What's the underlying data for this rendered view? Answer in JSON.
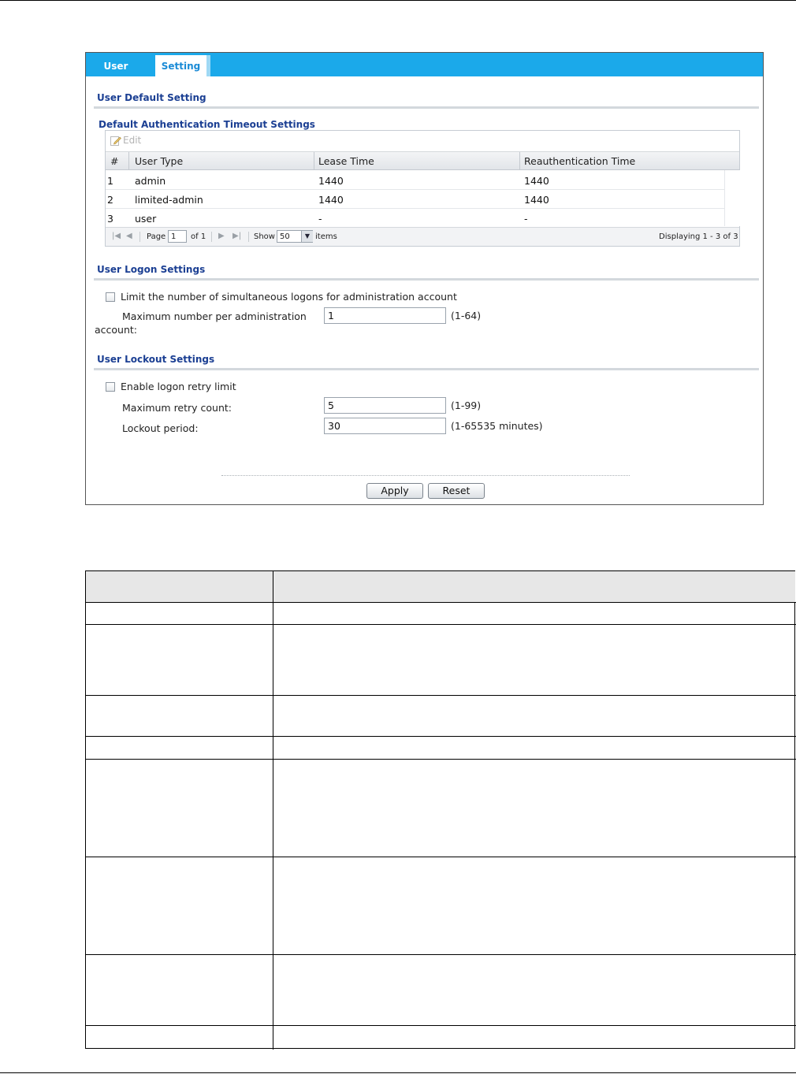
{
  "tabs": [
    {
      "label": "User",
      "active": false
    },
    {
      "label": "Setting",
      "active": true
    }
  ],
  "user_default": {
    "title": "User Default Setting",
    "subtitle": "Default Authentication Timeout Settings",
    "edit_label": "Edit",
    "columns": [
      "#",
      "User Type",
      "Lease Time",
      "Reauthentication Time"
    ],
    "rows": [
      {
        "num": "1",
        "type": "admin",
        "lease": "1440",
        "reauth": "1440"
      },
      {
        "num": "2",
        "type": "limited-admin",
        "lease": "1440",
        "reauth": "1440"
      },
      {
        "num": "3",
        "type": "user",
        "lease": "-",
        "reauth": "-"
      }
    ],
    "pager": {
      "page_label": "Page",
      "page_value": "1",
      "of_label": "of 1",
      "show_label": "Show",
      "show_value": "50",
      "items_label": "items",
      "displaying": "Displaying 1 - 3 of 3"
    }
  },
  "logon": {
    "title": "User Logon Settings",
    "limit_checkbox_label": "Limit the number of simultaneous logons for administration account",
    "limit_checked": false,
    "max_label_line1": "Maximum number per administration",
    "max_label_line2": "account:",
    "max_value": "1",
    "max_hint": "(1-64)"
  },
  "lockout": {
    "title": "User Lockout Settings",
    "enable_label": "Enable logon retry limit",
    "enable_checked": false,
    "retry_label": "Maximum retry count:",
    "retry_value": "5",
    "retry_hint": "(1-99)",
    "period_label": "Lockout period:",
    "period_value": "30",
    "period_hint": "(1-65535 minutes)"
  },
  "buttons": {
    "apply": "Apply",
    "reset": "Reset"
  },
  "colors": {
    "tab_bar": "#1ba9ea",
    "section_title": "#1b3f93",
    "active_tab_text": "#1b8bd6"
  }
}
